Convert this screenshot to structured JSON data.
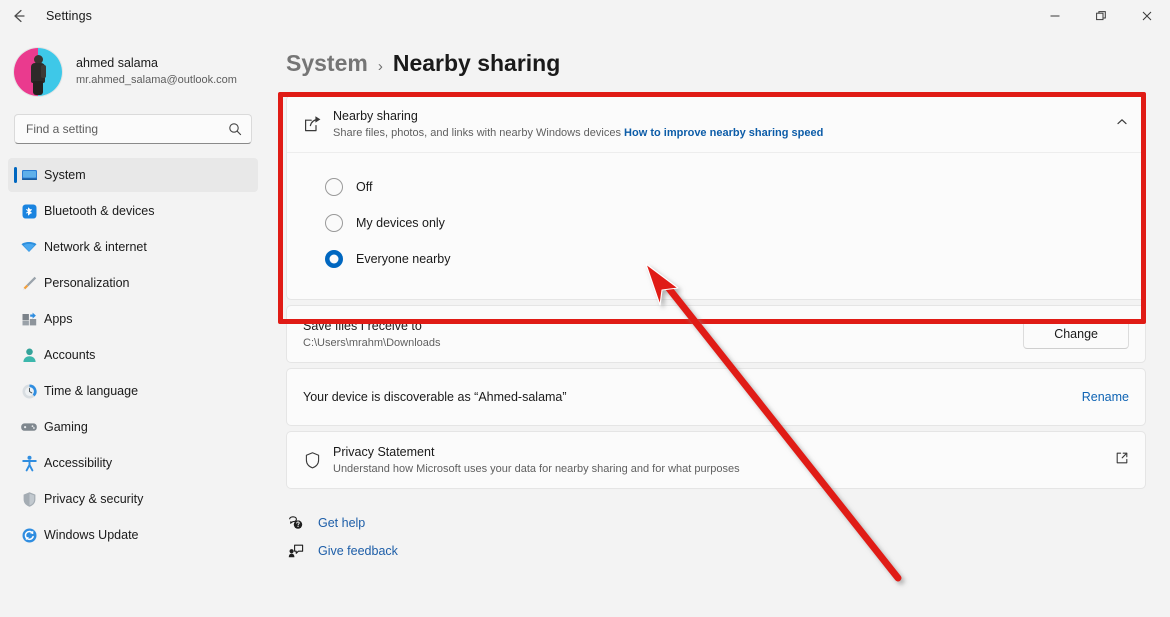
{
  "window": {
    "title": "Settings",
    "back_icon": "back-arrow-icon",
    "minimize_label": "Minimize",
    "maximize_label": "Restore",
    "close_label": "Close"
  },
  "sidebar": {
    "profile": {
      "name": "ahmed salama",
      "email": "mr.ahmed_salama@outlook.com"
    },
    "search": {
      "placeholder": "Find a setting",
      "value": "",
      "icon": "search-icon"
    },
    "items": [
      {
        "label": "System",
        "icon": "monitor-icon",
        "selected": true
      },
      {
        "label": "Bluetooth & devices",
        "icon": "bluetooth-icon",
        "selected": false
      },
      {
        "label": "Network & internet",
        "icon": "wifi-icon",
        "selected": false
      },
      {
        "label": "Personalization",
        "icon": "paintbrush-icon",
        "selected": false
      },
      {
        "label": "Apps",
        "icon": "apps-icon",
        "selected": false
      },
      {
        "label": "Accounts",
        "icon": "person-icon",
        "selected": false
      },
      {
        "label": "Time & language",
        "icon": "clock-icon",
        "selected": false
      },
      {
        "label": "Gaming",
        "icon": "gamepad-icon",
        "selected": false
      },
      {
        "label": "Accessibility",
        "icon": "accessibility-icon",
        "selected": false
      },
      {
        "label": "Privacy & security",
        "icon": "shield-icon",
        "selected": false
      },
      {
        "label": "Windows Update",
        "icon": "update-icon",
        "selected": false
      }
    ]
  },
  "breadcrumb": {
    "parent": "System",
    "separator": "›",
    "current": "Nearby sharing"
  },
  "nearby_sharing": {
    "icon": "share-icon",
    "title": "Nearby sharing",
    "description": "Share files, photos, and links with nearby Windows devices",
    "link_label": "How to improve nearby sharing speed",
    "expand_icon": "chevron-up-icon",
    "options": [
      {
        "label": "Off",
        "selected": false
      },
      {
        "label": "My devices only",
        "selected": false
      },
      {
        "label": "Everyone nearby",
        "selected": true
      }
    ]
  },
  "save_files": {
    "title": "Save files I receive to",
    "path": "C:\\Users\\mrahm\\Downloads",
    "button_label": "Change"
  },
  "discoverable": {
    "text": "Your device is discoverable as “Ahmed-salama”",
    "action_label": "Rename"
  },
  "privacy": {
    "icon": "shield-outline-icon",
    "title": "Privacy Statement",
    "description": "Understand how Microsoft uses your data for nearby sharing and for what purposes",
    "external_icon": "external-link-icon"
  },
  "footer": {
    "links": [
      {
        "label": "Get help",
        "icon": "help-icon"
      },
      {
        "label": "Give feedback",
        "icon": "feedback-icon"
      }
    ]
  },
  "annotations": {
    "highlight_color": "#e01b15",
    "arrow_color": "#e01b15"
  }
}
